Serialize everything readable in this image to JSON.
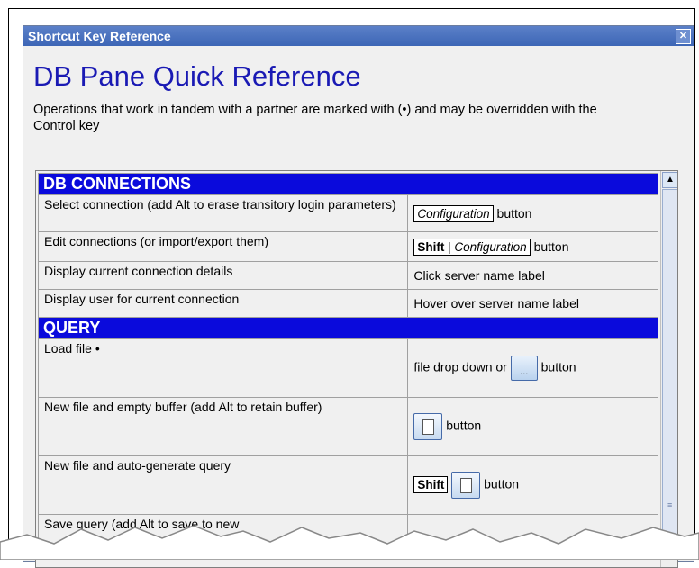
{
  "window": {
    "title": "Shortcut Key Reference",
    "close_label": "✕"
  },
  "heading": "DB Pane Quick Reference",
  "description": "Operations that work in tandem with a partner are marked with (•) and may be overridden with the Control key",
  "sections": {
    "connections": {
      "title": "DB CONNECTIONS",
      "rows": [
        {
          "action": "Select connection (add Alt to erase transitory login parameters)",
          "key_label": "Configuration",
          "suffix": "button"
        },
        {
          "action": "Edit connections (or import/export them)",
          "shift_label": "Shift",
          "key_label": "Configuration",
          "suffix": "button"
        },
        {
          "action": "Display current connection details",
          "how": "Click server name label"
        },
        {
          "action": "Display user for current connection",
          "how": "Hover over server name label"
        }
      ]
    },
    "query": {
      "title": "QUERY",
      "rows": [
        {
          "action": "Load file •",
          "prefix": "file drop down or",
          "button_label": "...",
          "suffix": "button"
        },
        {
          "action": "New file and empty buffer (add Alt to retain buffer)",
          "suffix": "button"
        },
        {
          "action": "New file and auto-generate query",
          "shift_label": "Shift",
          "suffix": "button"
        },
        {
          "action": "Save query (add Alt to save to new"
        }
      ]
    }
  },
  "icons": [
    "close-icon",
    "new-file-icon",
    "scroll-up-icon",
    "scroll-grip-icon"
  ]
}
